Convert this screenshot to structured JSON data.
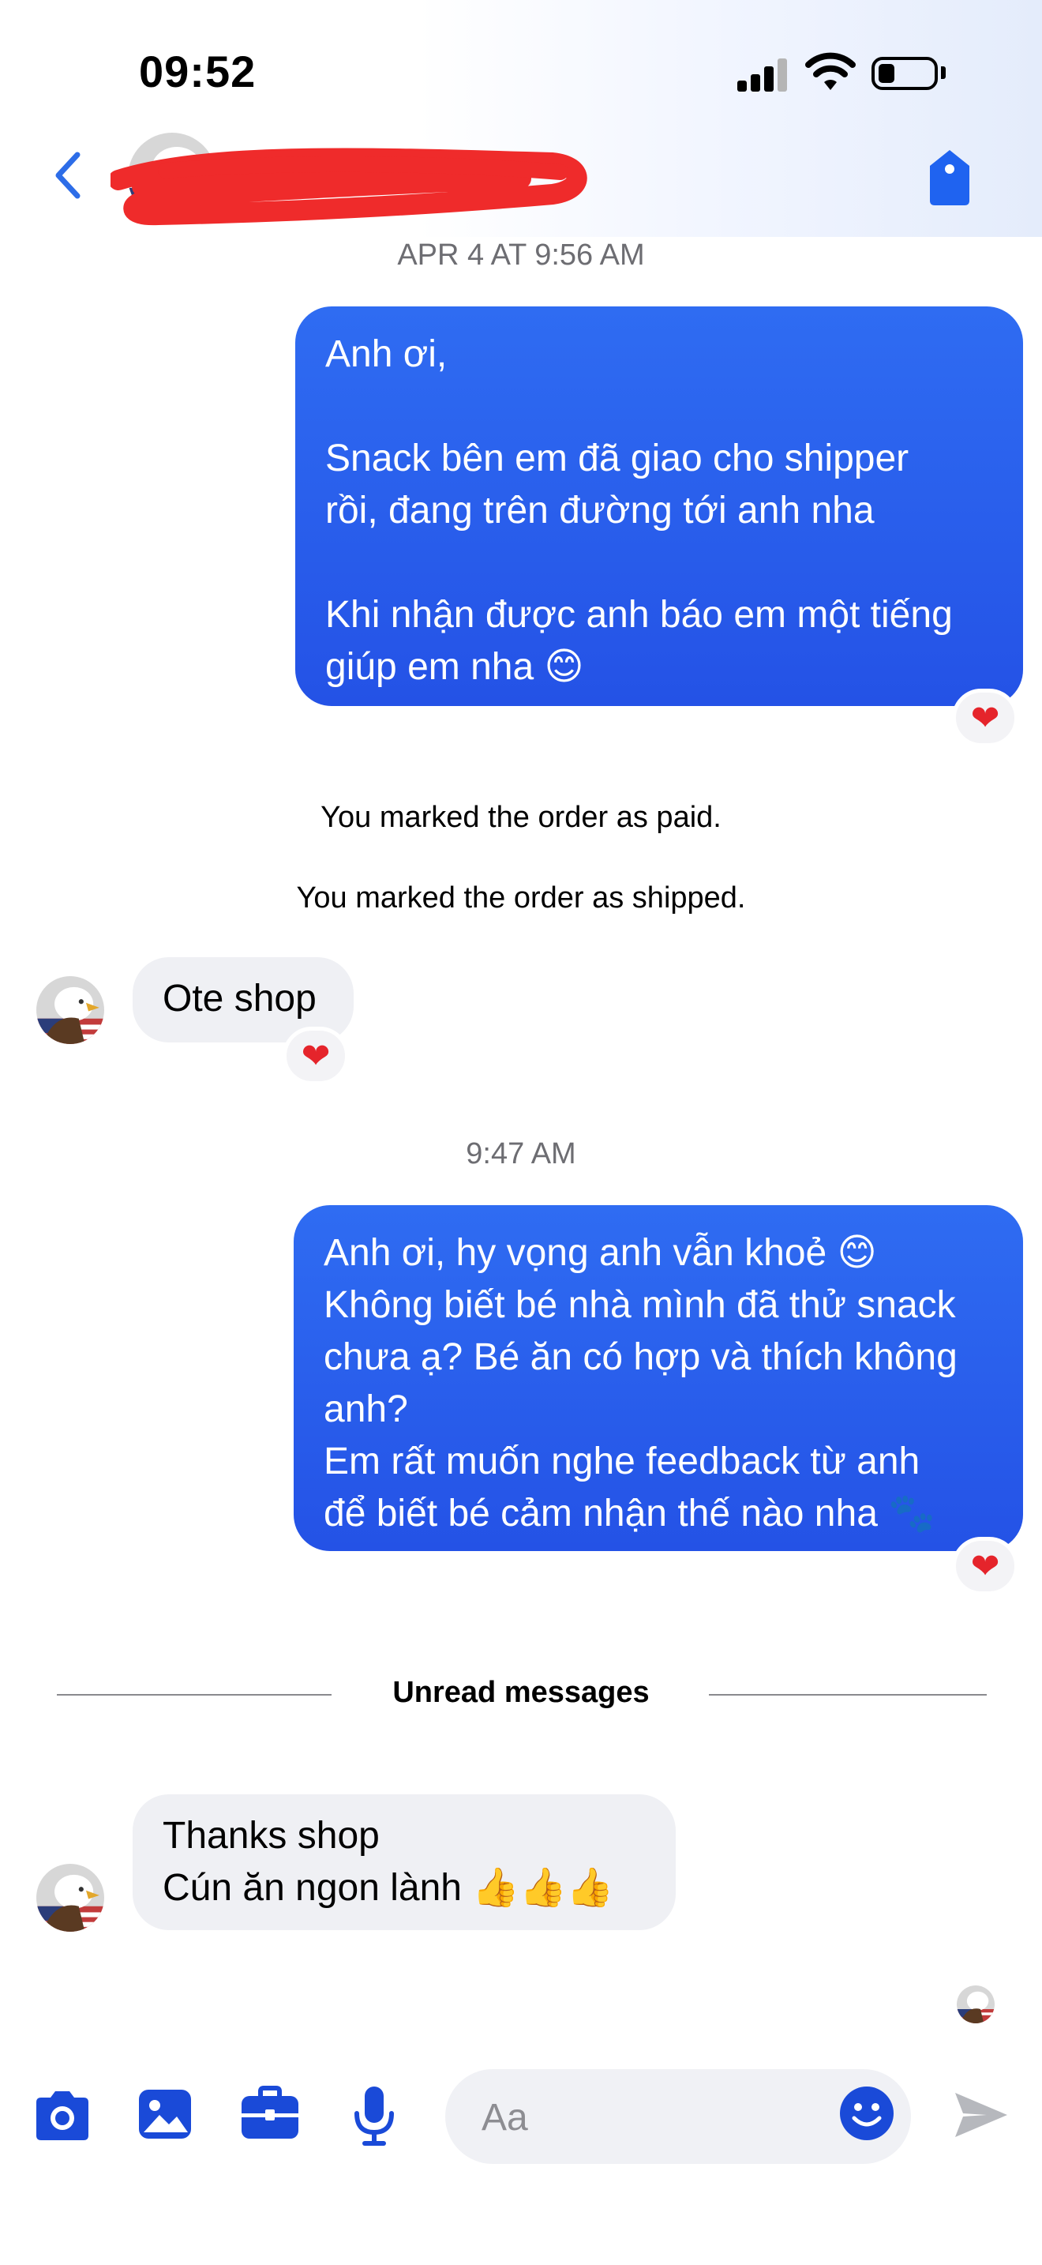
{
  "status_bar": {
    "time": "09:52"
  },
  "header": {
    "contact_name": "redacted"
  },
  "thread": {
    "timestamp_1": "APR 4 AT 9:56 AM",
    "message_1_lines": [
      "Anh ơi,",
      "",
      "Snack bên em đã giao cho shipper",
      "rồi, đang trên đường tới anh nha",
      "",
      "Khi nhận được anh báo em một tiếng",
      "giúp em nha 😊"
    ],
    "reaction_1": "❤",
    "system_1": "You marked the order as paid.",
    "system_2": "You marked the order as shipped.",
    "message_2": "Ote shop",
    "reaction_2": "❤",
    "timestamp_2": "9:47 AM",
    "message_3_lines": [
      "Anh ơi, hy vọng anh vẫn khoẻ 😊",
      "Không biết bé nhà mình đã thử snack",
      "chưa ạ? Bé ăn có hợp và thích không",
      "anh?",
      "Em rất muốn nghe feedback từ anh",
      "để biết bé cảm nhận thế nào nha 🐾"
    ],
    "reaction_3": "❤",
    "unread_divider": "Unread messages",
    "message_4_lines": [
      "Thanks shop",
      "Cún ăn ngon lành 👍👍👍"
    ]
  },
  "composer": {
    "placeholder": "Aa"
  },
  "colors": {
    "accent": "#1a4ad8",
    "outgoing_bubble": "#2f6cf2",
    "incoming_bubble": "#eff0f4",
    "reaction_heart": "#e5242b"
  },
  "icons": {
    "back": "chevron-left-icon",
    "tag": "tag-icon",
    "camera": "camera-icon",
    "gallery": "image-icon",
    "business_tools": "briefcase-icon",
    "voice": "microphone-icon",
    "emoji": "smiley-icon",
    "send": "send-icon"
  }
}
